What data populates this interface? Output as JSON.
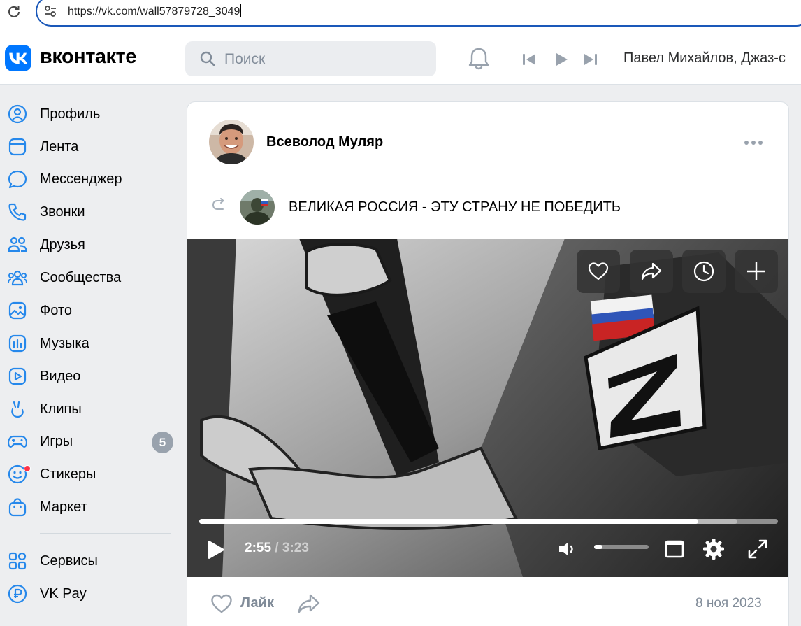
{
  "browser": {
    "url": "https://vk.com/wall57879728_3049"
  },
  "header": {
    "logo_text": "вконтакте",
    "search_placeholder": "Поиск",
    "now_playing": "Павел Михайлов, Джаз-с"
  },
  "sidebar": {
    "items": [
      {
        "label": "Профиль",
        "icon": "profile-icon"
      },
      {
        "label": "Лента",
        "icon": "feed-icon"
      },
      {
        "label": "Мессенджер",
        "icon": "messenger-icon"
      },
      {
        "label": "Звонки",
        "icon": "phone-icon"
      },
      {
        "label": "Друзья",
        "icon": "friends-icon"
      },
      {
        "label": "Сообщества",
        "icon": "communities-icon"
      },
      {
        "label": "Фото",
        "icon": "photo-icon"
      },
      {
        "label": "Музыка",
        "icon": "music-icon"
      },
      {
        "label": "Видео",
        "icon": "video-icon"
      },
      {
        "label": "Клипы",
        "icon": "clips-icon"
      },
      {
        "label": "Игры",
        "icon": "games-icon",
        "badge": "5"
      },
      {
        "label": "Стикеры",
        "icon": "stickers-icon"
      },
      {
        "label": "Маркет",
        "icon": "market-icon"
      },
      {
        "label": "Сервисы",
        "icon": "services-icon"
      },
      {
        "label": "VK Pay",
        "icon": "vkpay-icon"
      }
    ]
  },
  "post": {
    "author": "Всеволод Муляр",
    "repost_title": "ВЕЛИКАЯ РОССИЯ - ЭТУ СТРАНУ НЕ ПОБЕДИТЬ",
    "video": {
      "current_time": "2:55",
      "separator": " / ",
      "duration": "3:23",
      "progress_fraction": 0.862,
      "buffered_fraction": 0.93,
      "volume_fraction": 0.15
    },
    "like_label": "Лайк",
    "date": "8 ноя 2023"
  },
  "colors": {
    "accent": "#0077ff",
    "nav_icon": "#2688eb",
    "secondary_text": "#818c99",
    "badge": "#99a2ad",
    "notification_dot": "#ff3347"
  }
}
